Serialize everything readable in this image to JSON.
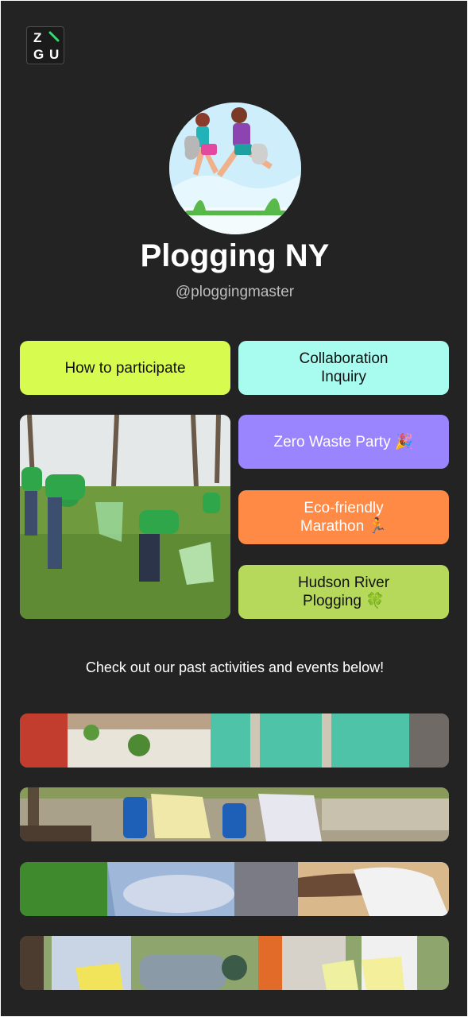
{
  "logo": {
    "letters": [
      "Z",
      "G",
      "U"
    ],
    "mark": "slash"
  },
  "profile": {
    "name": "Plogging NY",
    "handle": "@ploggingmaster"
  },
  "buttons": {
    "how_to_participate": "How to participate",
    "collaboration_inquiry": "Collaboration\nInquiry",
    "zero_waste_party": "Zero Waste Party 🎉",
    "eco_marathon": "Eco-friendly\nMarathon 🏃",
    "hudson_river": "Hudson River\nPlogging 🍀"
  },
  "caption": "Check out our past activities and events below!",
  "colors": {
    "background": "#232323",
    "how_to_participate": "#d8fb4f",
    "collaboration_inquiry": "#a8fbef",
    "zero_waste_party": "#9b85ff",
    "eco_marathon": "#ff8a45",
    "hudson_river": "#b6d95c"
  }
}
